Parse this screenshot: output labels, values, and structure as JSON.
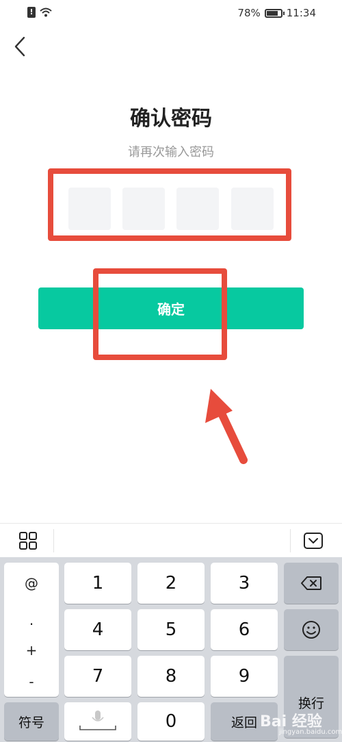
{
  "status_bar": {
    "battery_percent": "78%",
    "time": "11:34"
  },
  "header": {
    "title": "确认密码",
    "subtitle": "请再次输入密码"
  },
  "pin": {
    "length": 4
  },
  "confirm_button": {
    "label": "确定",
    "color": "#07c9a0"
  },
  "annotation": {
    "highlight_color": "#e74c3c"
  },
  "keyboard": {
    "symbols": [
      "@",
      ".",
      "+",
      "-"
    ],
    "digits_row1": [
      "1",
      "2",
      "3"
    ],
    "digits_row2": [
      "4",
      "5",
      "6"
    ],
    "digits_row3": [
      "7",
      "8",
      "9"
    ],
    "symbol_key": "符号",
    "zero_key": "0",
    "return_key": "返回",
    "enter_key": "换行"
  },
  "watermark": {
    "brand": "Bai 经验",
    "site": "jingyan.baidu.com"
  }
}
